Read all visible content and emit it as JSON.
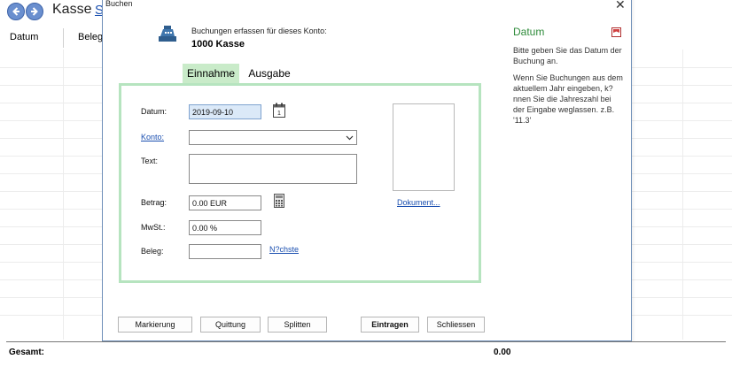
{
  "main": {
    "title": "Kasse",
    "link_fragment": "S",
    "columns": [
      "Datum",
      "Beleg"
    ],
    "total_label": "Gesamt:",
    "total_value": "0.00"
  },
  "dialog": {
    "title": "Buchen",
    "account_label": "Buchungen erfassen für dieses Konto:",
    "account_name": "1000 Kasse",
    "tabs": [
      "Einnahme",
      "Ausgabe"
    ],
    "form": {
      "datum_label": "Datum:",
      "datum_value": "2019-09-10",
      "konto_label": "Konto:",
      "konto_value": "",
      "text_label": "Text:",
      "text_value": "",
      "betrag_label": "Betrag:",
      "betrag_value": "0.00 EUR",
      "mwst_label": "MwSt.:",
      "mwst_value": "0.00 %",
      "beleg_label": "Beleg:",
      "beleg_value": "",
      "next_link": "N?chste",
      "document_link": "Dokument..."
    },
    "buttons": {
      "markierung": "Markierung",
      "quittung": "Quittung",
      "splitten": "Splitten",
      "eintragen": "Eintragen",
      "schliessen": "Schliessen"
    },
    "close_symbol": "✕"
  },
  "help": {
    "title": "Datum",
    "p1": "Bitte geben Sie das Datum der Buchung an.",
    "p2": "Wenn Sie Buchungen aus dem aktuellem Jahr eingeben, k?nnen Sie die Jahreszahl bei der Eingabe weglassen. z.B. '11.3'"
  },
  "colors": {
    "accent_green": "#2e8b3a",
    "tab_active": "#c9ebc9",
    "panel_border": "#b6e4bf",
    "link": "#1a4fb0"
  },
  "icons": [
    "back-arrow-icon",
    "forward-arrow-icon",
    "cash-register-icon",
    "calendar-icon",
    "calculator-icon",
    "chevron-down-icon",
    "help-bookmark-icon"
  ]
}
